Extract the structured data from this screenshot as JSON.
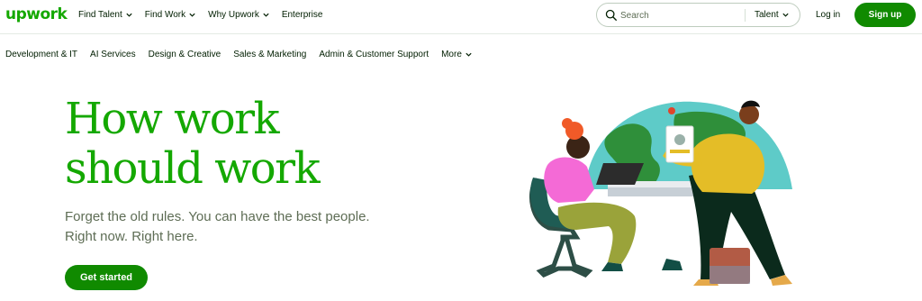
{
  "header": {
    "logo": "upwork",
    "nav": [
      {
        "label": "Find Talent",
        "has_menu": true
      },
      {
        "label": "Find Work",
        "has_menu": true
      },
      {
        "label": "Why Upwork",
        "has_menu": true
      },
      {
        "label": "Enterprise",
        "has_menu": false
      }
    ],
    "search": {
      "placeholder": "Search",
      "value": "",
      "scope": "Talent"
    },
    "login_label": "Log in",
    "signup_label": "Sign up"
  },
  "categories": {
    "items": [
      "Development & IT",
      "AI Services",
      "Design & Creative",
      "Sales & Marketing",
      "Admin & Customer Support"
    ],
    "more_label": "More"
  },
  "hero": {
    "title_line1": "How work",
    "title_line2": "should work",
    "subtitle_line1": "Forget the old rules. You can have the best people.",
    "subtitle_line2": "Right now. Right here.",
    "cta_label": "Get started"
  },
  "colors": {
    "brand_green": "#14a800",
    "button_green": "#108a00",
    "text_dark": "#001e00",
    "text_muted": "#5e6d55"
  },
  "icons": [
    "search-icon",
    "chevron-down-icon"
  ]
}
